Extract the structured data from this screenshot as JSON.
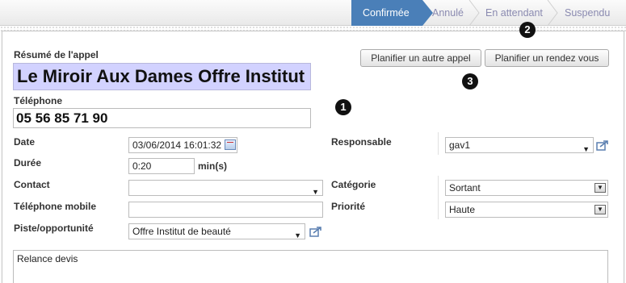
{
  "statusbar": {
    "stages": [
      {
        "label": "Confirmée",
        "active": true
      },
      {
        "label": "Annulé",
        "active": false
      },
      {
        "label": "En attendant",
        "active": false
      },
      {
        "label": "Suspendu",
        "active": false
      }
    ]
  },
  "form": {
    "summary_label": "Résumé de l'appel",
    "summary_value": "Le Miroir Aux Dames Offre Institut de beauté",
    "phone_label": "Téléphone",
    "phone_value": "05 56 85 71 90",
    "buttons": {
      "schedule_call": "Planifier un autre appel",
      "schedule_meeting": "Planifier un rendez vous"
    },
    "date_label": "Date",
    "date_value": "03/06/2014 16:01:32",
    "duration_label": "Durée",
    "duration_value": "0:20",
    "duration_unit": "min(s)",
    "contact_label": "Contact",
    "contact_value": "",
    "mobile_label": "Téléphone mobile",
    "mobile_value": "",
    "opportunity_label": "Piste/opportunité",
    "opportunity_value": "Offre Institut de beauté",
    "responsible_label": "Responsable",
    "responsible_value": "gav1",
    "category_label": "Catégorie",
    "category_value": "Sortant",
    "priority_label": "Priorité",
    "priority_value": "Haute",
    "notes_value": "Relance devis"
  },
  "annotations": [
    "1",
    "2",
    "3"
  ]
}
